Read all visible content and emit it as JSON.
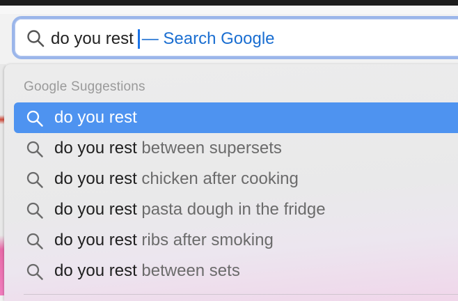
{
  "address_bar": {
    "typed_text": "do you rest",
    "hint_text": "— Search Google",
    "icon": "search-icon"
  },
  "suggestions_panel": {
    "header": "Google Suggestions",
    "items": [
      {
        "typed": "do you rest",
        "completion": "",
        "selected": true,
        "icon": "search-icon"
      },
      {
        "typed": "do you rest",
        "completion": " between supersets",
        "selected": false,
        "icon": "search-icon"
      },
      {
        "typed": "do you rest",
        "completion": " chicken after cooking",
        "selected": false,
        "icon": "search-icon"
      },
      {
        "typed": "do you rest",
        "completion": " pasta dough in the fridge",
        "selected": false,
        "icon": "search-icon"
      },
      {
        "typed": "do you rest",
        "completion": " ribs after smoking",
        "selected": false,
        "icon": "search-icon"
      },
      {
        "typed": "do you rest",
        "completion": " between sets",
        "selected": false,
        "icon": "search-icon"
      }
    ]
  },
  "colors": {
    "accent": "#4e93f0",
    "focus_ring": "#9bb6ea",
    "hint": "#1a6ed1"
  }
}
